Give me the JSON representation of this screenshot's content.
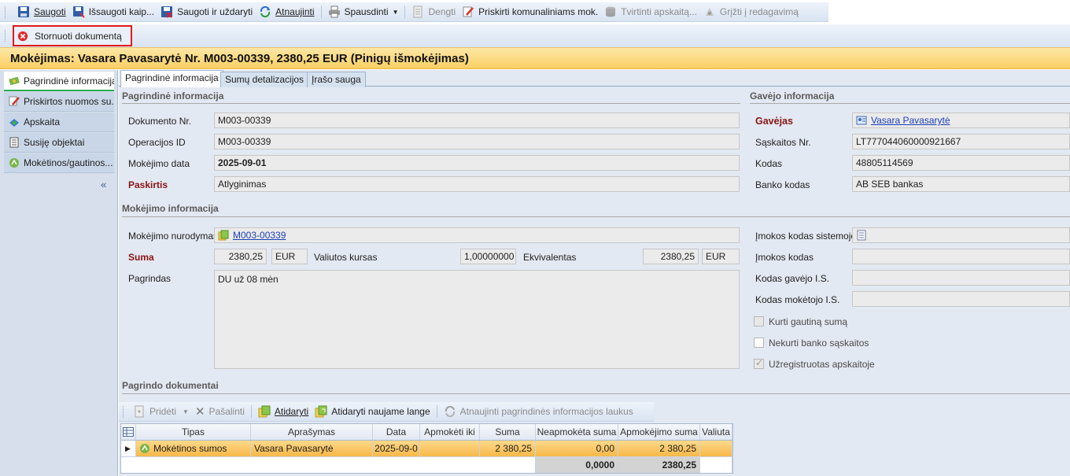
{
  "toolbar": {
    "save": "Saugoti",
    "save_as": "Išsaugoti kaip...",
    "save_close": "Saugoti ir uždaryti",
    "refresh": "Atnaujinti",
    "print": "Spausdinti",
    "cover": "Dengti",
    "assign_utilities": "Priskirti komunaliniams mok.",
    "confirm_accounting": "Tvirtinti apskaitą...",
    "return_edit": "Grįžti į redagavimą",
    "cancel_document": "Stornuoti dokumentą"
  },
  "title": "Mokėjimas: Vasara Pavasarytė Nr. M003-00339, 2380,25 EUR (Pinigų išmokėjimas)",
  "nav": {
    "items": [
      "Pagrindinė informacija",
      "Priskirtos nuomos su...",
      "Apskaita",
      "Susiję objektai",
      "Mokėtinos/gautinos..."
    ],
    "collapse": "«"
  },
  "tabs": [
    "Pagrindinė informacija",
    "Sumų detalizacijos",
    "Įrašo sauga"
  ],
  "basic": {
    "header": "Pagrindinė informacija",
    "doc_no_label": "Dokumento Nr.",
    "doc_no": "M003-00339",
    "op_id_label": "Operacijos ID",
    "op_id": "M003-00339",
    "date_label": "Mokėjimo data",
    "date": "2025-09-01",
    "purpose_label": "Paskirtis",
    "purpose": "Atlyginimas"
  },
  "recipient": {
    "header": "Gavėjo informacija",
    "recipient_label": "Gavėjas",
    "recipient": "Vasara Pavasarytė",
    "account_label": "Sąskaitos Nr.",
    "account": "LT777044060000921667",
    "code_label": "Kodas",
    "code": "48805114569",
    "bank_code_label": "Banko kodas",
    "bank_code": "AB SEB bankas"
  },
  "payment": {
    "header": "Mokėjimo informacija",
    "order_label": "Mokėjimo nurodymas",
    "order": "M003-00339",
    "amount_label": "Suma",
    "amount": "2380,25",
    "currency": "EUR",
    "rate_label": "Valiutos kursas",
    "rate": "1,00000000",
    "equivalent_label": "Ekvivalentas",
    "equivalent": "2380,25",
    "equivalent_currency": "EUR",
    "basis_label": "Pagrindas",
    "basis": "DU už 08 mėn",
    "sys_code_label": "Įmokos kodas sistemoje",
    "pay_code_label": "Įmokos kodas",
    "recipient_is_label": "Kodas gavėjo I.S.",
    "payer_is_label": "Kodas mokėtojo I.S.",
    "chk_create_label": "Kurti gautiną sumą",
    "chk_no_bank_label": "Nekurti banko sąskaitos",
    "chk_registered_label": "Užregistruotas apskaitoje"
  },
  "docs": {
    "header": "Pagrindo dokumentai",
    "toolbar": {
      "add": "Pridėti",
      "remove": "Pašalinti",
      "open": "Atidaryti",
      "open_new": "Atidaryti naujame lange",
      "refresh_fields": "Atnaujinti pagrindinės informacijos laukus"
    },
    "columns": [
      "Tipas",
      "Aprašymas",
      "Data",
      "Apmokėti iki",
      "Suma",
      "Neapmokėta suma",
      "Apmokėjimo suma",
      "Valiuta"
    ],
    "row": {
      "type": "Mokėtinos sumos",
      "description": "Vasara Pavasarytė",
      "date": "2025-09-0",
      "due": "",
      "amount": "2 380,25",
      "unpaid": "0,00",
      "payment": "2 380,25",
      "currency": ""
    },
    "totals": {
      "unpaid": "0,0000",
      "payment": "2380,25"
    }
  }
}
